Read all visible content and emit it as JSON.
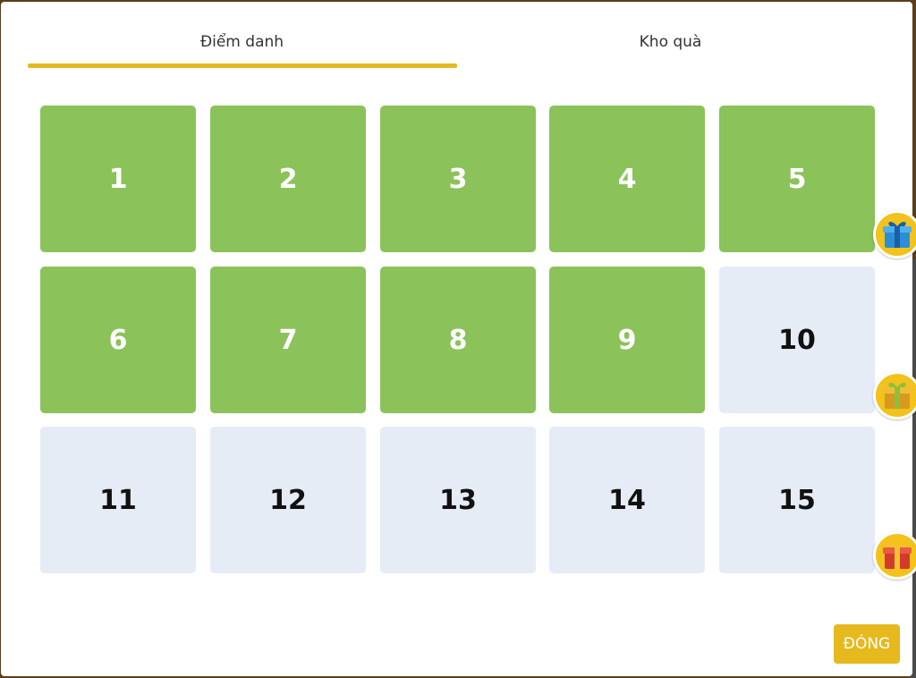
{
  "tabs": {
    "checkin": "Điểm danh",
    "gift_store": "Kho quà"
  },
  "days": [
    {
      "label": "1",
      "status": "checked"
    },
    {
      "label": "2",
      "status": "checked"
    },
    {
      "label": "3",
      "status": "checked"
    },
    {
      "label": "4",
      "status": "checked"
    },
    {
      "label": "5",
      "status": "checked",
      "gift": "gift-blue-icon"
    },
    {
      "label": "6",
      "status": "checked"
    },
    {
      "label": "7",
      "status": "checked"
    },
    {
      "label": "8",
      "status": "checked"
    },
    {
      "label": "9",
      "status": "checked"
    },
    {
      "label": "10",
      "status": "unchecked",
      "gift": "gift-gold-icon"
    },
    {
      "label": "11",
      "status": "unchecked"
    },
    {
      "label": "12",
      "status": "unchecked"
    },
    {
      "label": "13",
      "status": "unchecked"
    },
    {
      "label": "14",
      "status": "unchecked"
    },
    {
      "label": "15",
      "status": "unchecked",
      "gift": "gift-red-icon"
    }
  ],
  "close_label": "ĐÓNG",
  "colors": {
    "accent": "#e6b91e",
    "checked": "#8bc25a",
    "unchecked": "#e6ecf5"
  }
}
